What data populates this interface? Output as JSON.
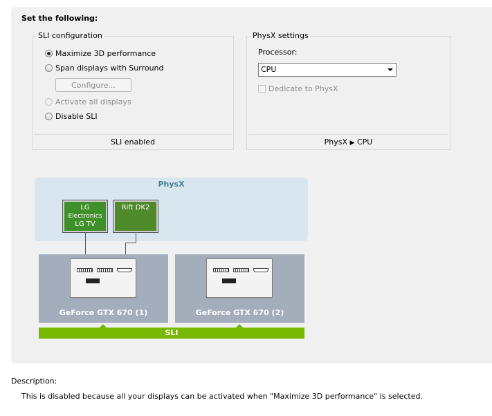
{
  "header": {
    "title": "Set the following:"
  },
  "sli": {
    "legend": "SLI configuration",
    "options": [
      {
        "label": "Maximize 3D performance",
        "state": "checked"
      },
      {
        "label": "Span displays with Surround",
        "state": "unchecked"
      },
      {
        "label": "Activate all displays",
        "state": "disabled"
      },
      {
        "label": "Disable SLI",
        "state": "unchecked"
      }
    ],
    "configure_label": "Configure...",
    "footer": "SLI enabled"
  },
  "physx": {
    "legend": "PhysX settings",
    "processor_label": "Processor:",
    "processor_value": "CPU",
    "dedicate_label": "Dedicate to PhysX",
    "footer_left": "PhysX",
    "footer_right": "CPU"
  },
  "diagram": {
    "physx_label": "PhysX",
    "monitors": [
      {
        "name": "LG Electronics LG TV",
        "line1": "LG",
        "line2": "Electronics",
        "line3": "LG TV"
      },
      {
        "name": "Rift DK2",
        "line1": "Rift DK2",
        "line2": "",
        "line3": ""
      }
    ],
    "gpus": [
      "GeForce GTX 670 (1)",
      "GeForce GTX 670 (2)"
    ],
    "sli_label": "SLI",
    "colors": {
      "sli_bar": "#76b900",
      "physx_band": "#d7e6ef",
      "gpu": "#a3adbc"
    }
  },
  "description": {
    "title": "Description:",
    "text": "This is disabled because all your displays can be activated when \"Maximize 3D performance\" is selected."
  }
}
